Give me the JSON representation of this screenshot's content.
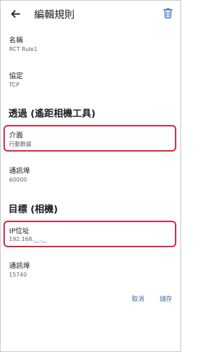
{
  "header": {
    "title": "編輯規則",
    "back_icon": "arrow-left-icon",
    "delete_icon": "trash-icon"
  },
  "fields": {
    "name": {
      "label": "名稱",
      "value": "RCT Rule1"
    },
    "protocol": {
      "label": "協定",
      "value": "TCP"
    }
  },
  "section_source": {
    "title": "透過 (遙距相機工具)",
    "interface": {
      "label": "介面",
      "value": "行動數據"
    },
    "port": {
      "label": "通訊埠",
      "value": "60000"
    }
  },
  "section_target": {
    "title": "目標 (相機)",
    "ip": {
      "label": "IP位址",
      "value": "192.168.__.__"
    },
    "port": {
      "label": "通訊埠",
      "value": "15740"
    }
  },
  "actions": {
    "cancel_label": "取消",
    "save_label": "儲存"
  },
  "colors": {
    "accent": "#3f6aa8",
    "delete_icon": "#3b73c4",
    "highlight": "#d7263d",
    "primary_text": "#202124",
    "secondary_text": "#5f6368"
  }
}
